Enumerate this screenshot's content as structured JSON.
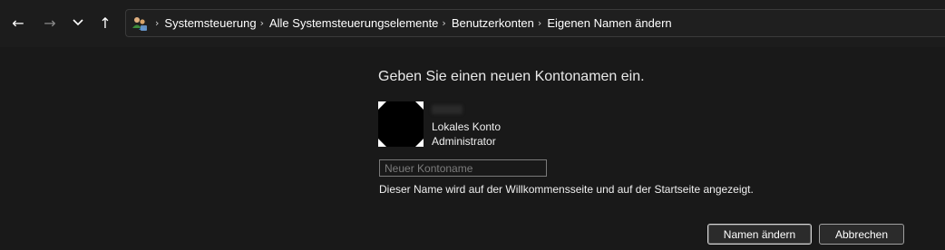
{
  "nav": {
    "back_glyph": "←",
    "forward_glyph": "→",
    "recent_glyph": "⌄",
    "up_glyph": "↑"
  },
  "address": {
    "icon": "users-control-panel-icon",
    "separator": "›",
    "crumbs": [
      "Systemsteuerung",
      "Alle Systemsteuerungselemente",
      "Benutzerkonten",
      "Eigenen Namen ändern"
    ]
  },
  "main": {
    "heading": "Geben Sie einen neuen Kontonamen ein.",
    "account": {
      "type": "Lokales Konto",
      "role": "Administrator"
    },
    "input": {
      "placeholder": "Neuer Kontoname",
      "value": ""
    },
    "hint": "Dieser Name wird auf der Willkommensseite und auf der Startseite angezeigt."
  },
  "buttons": {
    "change": "Namen ändern",
    "cancel": "Abbrechen"
  },
  "colors": {
    "background": "#191919",
    "toolbar": "#1c1c1c",
    "text": "#ffffff",
    "input_border": "#7a7a7a"
  }
}
